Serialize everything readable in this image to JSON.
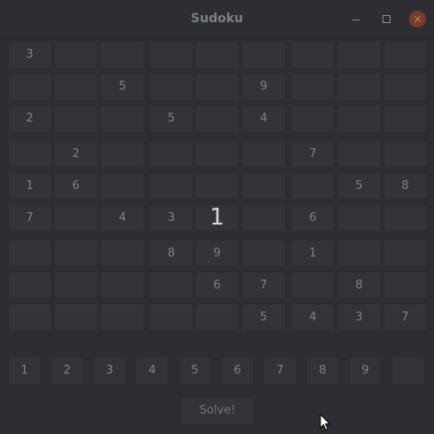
{
  "window": {
    "title": "Sudoku"
  },
  "grid": [
    [
      "3",
      "",
      "",
      "",
      "",
      "",
      "",
      "",
      ""
    ],
    [
      "",
      "",
      "5",
      "",
      "",
      "9",
      "",
      "",
      ""
    ],
    [
      "2",
      "",
      "",
      "5",
      "",
      "4",
      "",
      "",
      ""
    ],
    [
      "",
      "2",
      "",
      "",
      "",
      "",
      "7",
      "",
      ""
    ],
    [
      "1",
      "6",
      "",
      "",
      "",
      "",
      "",
      "5",
      "8"
    ],
    [
      "7",
      "",
      "4",
      "3",
      "1",
      "",
      "6",
      "",
      ""
    ],
    [
      "",
      "",
      "",
      "8",
      "9",
      "",
      "1",
      "",
      ""
    ],
    [
      "",
      "",
      "",
      "",
      "6",
      "7",
      "",
      "8",
      ""
    ],
    [
      "",
      "",
      "",
      "",
      "",
      "5",
      "4",
      "3",
      "7"
    ]
  ],
  "numpad": [
    "1",
    "2",
    "3",
    "4",
    "5",
    "6",
    "7",
    "8",
    "9",
    ""
  ],
  "solve_label": "Solve!"
}
